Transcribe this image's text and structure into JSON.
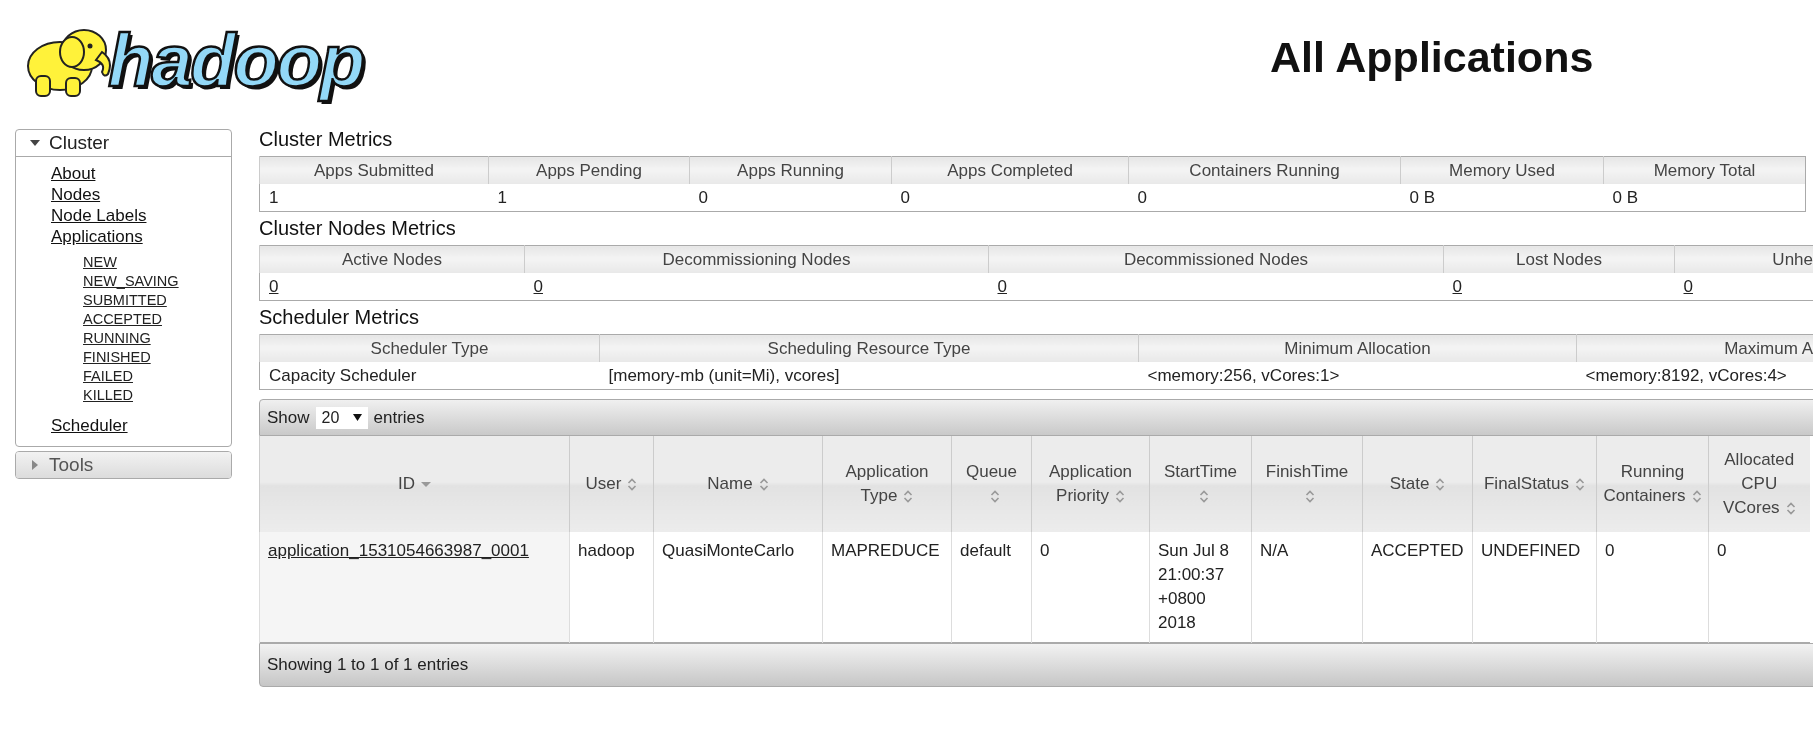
{
  "logo": {
    "text": "hadoop"
  },
  "page_title": "All Applications",
  "sidebar": {
    "sections": [
      {
        "title": "Cluster",
        "expanded": true,
        "items": [
          {
            "label": "About"
          },
          {
            "label": "Nodes"
          },
          {
            "label": "Node Labels"
          },
          {
            "label": "Applications",
            "children": [
              {
                "label": "NEW"
              },
              {
                "label": "NEW_SAVING"
              },
              {
                "label": "SUBMITTED"
              },
              {
                "label": "ACCEPTED"
              },
              {
                "label": "RUNNING"
              },
              {
                "label": "FINISHED"
              },
              {
                "label": "FAILED"
              },
              {
                "label": "KILLED"
              }
            ]
          },
          {
            "label": "Scheduler"
          }
        ]
      },
      {
        "title": "Tools",
        "expanded": false
      }
    ]
  },
  "cluster_metrics": {
    "title": "Cluster Metrics",
    "columns": [
      {
        "label": "Apps Submitted",
        "kind": "text"
      },
      {
        "label": "Apps Pending",
        "kind": "text"
      },
      {
        "label": "Apps Running",
        "kind": "text"
      },
      {
        "label": "Apps Completed",
        "kind": "text"
      },
      {
        "label": "Containers Running",
        "kind": "text"
      },
      {
        "label": "Memory Used",
        "kind": "text"
      },
      {
        "label": "Memory Total",
        "kind": "text"
      }
    ],
    "rows": [
      [
        "1",
        "1",
        "0",
        "0",
        "0",
        "0 B",
        "0 B"
      ]
    ]
  },
  "cluster_nodes_metrics": {
    "title": "Cluster Nodes Metrics",
    "columns": [
      {
        "label": "Active Nodes",
        "kind": "link"
      },
      {
        "label": "Decommissioning Nodes",
        "kind": "link"
      },
      {
        "label": "Decommissioned Nodes",
        "kind": "link"
      },
      {
        "label": "Lost Nodes",
        "kind": "link"
      },
      {
        "label": "Unhe",
        "kind": "link"
      }
    ],
    "rows": [
      [
        "0",
        "0",
        "0",
        "0",
        "0"
      ]
    ]
  },
  "scheduler_metrics": {
    "title": "Scheduler Metrics",
    "columns": [
      {
        "label": "Scheduler Type",
        "kind": "text"
      },
      {
        "label": "Scheduling Resource Type",
        "kind": "text"
      },
      {
        "label": "Minimum Allocation",
        "kind": "text"
      },
      {
        "label": "Maximum A",
        "kind": "text"
      }
    ],
    "rows": [
      [
        "Capacity Scheduler",
        "[memory-mb (unit=Mi), vcores]",
        "<memory:256, vCores:1>",
        "<memory:8192, vCores:4>"
      ]
    ]
  },
  "applications": {
    "show_label": "Show",
    "page_size": "20",
    "entries_label": "entries",
    "columns": [
      {
        "label": "ID",
        "kind": "link",
        "sorted": true
      },
      {
        "label": "User",
        "kind": "text",
        "sorted": false
      },
      {
        "label": "Name",
        "kind": "text",
        "sorted": false
      },
      {
        "label": "Application Type",
        "kind": "text",
        "sorted": false
      },
      {
        "label": "Queue",
        "kind": "text",
        "sorted": false
      },
      {
        "label": "Application Priority",
        "kind": "text",
        "sorted": false
      },
      {
        "label": "StartTime",
        "kind": "text",
        "sorted": false
      },
      {
        "label": "FinishTime",
        "kind": "text",
        "sorted": false
      },
      {
        "label": "State",
        "kind": "text",
        "sorted": false
      },
      {
        "label": "FinalStatus",
        "kind": "text",
        "sorted": false
      },
      {
        "label": "Running Containers",
        "kind": "text",
        "sorted": false
      },
      {
        "label": "Allocated CPU VCores",
        "kind": "text",
        "sorted": false
      }
    ],
    "rows": [
      [
        "application_1531054663987_0001",
        "hadoop",
        "QuasiMonteCarlo",
        "MAPREDUCE",
        "default",
        "0",
        "Sun Jul 8 21:00:37 +0800 2018",
        "N/A",
        "ACCEPTED",
        "UNDEFINED",
        "0",
        "0"
      ]
    ],
    "footer": "Showing 1 to 1 of 1 entries"
  }
}
